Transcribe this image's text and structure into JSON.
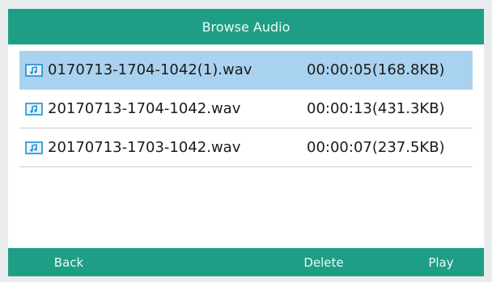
{
  "header": {
    "title": "Browse Audio"
  },
  "files": [
    {
      "name": "0170713-1704-1042(1).wav",
      "info": "00:00:05(168.8KB)",
      "icon": "audio-file-icon",
      "selected": true
    },
    {
      "name": "20170713-1704-1042.wav",
      "info": "00:00:13(431.3KB)",
      "icon": "audio-file-icon",
      "selected": false
    },
    {
      "name": "20170713-1703-1042.wav",
      "info": "00:00:07(237.5KB)",
      "icon": "audio-file-icon",
      "selected": false
    }
  ],
  "softkeys": {
    "back": "Back",
    "delete": "Delete",
    "play": "Play"
  },
  "colors": {
    "accent": "#1f9e86",
    "selection": "#a9d2ef",
    "icon": "#1f8fd0"
  }
}
